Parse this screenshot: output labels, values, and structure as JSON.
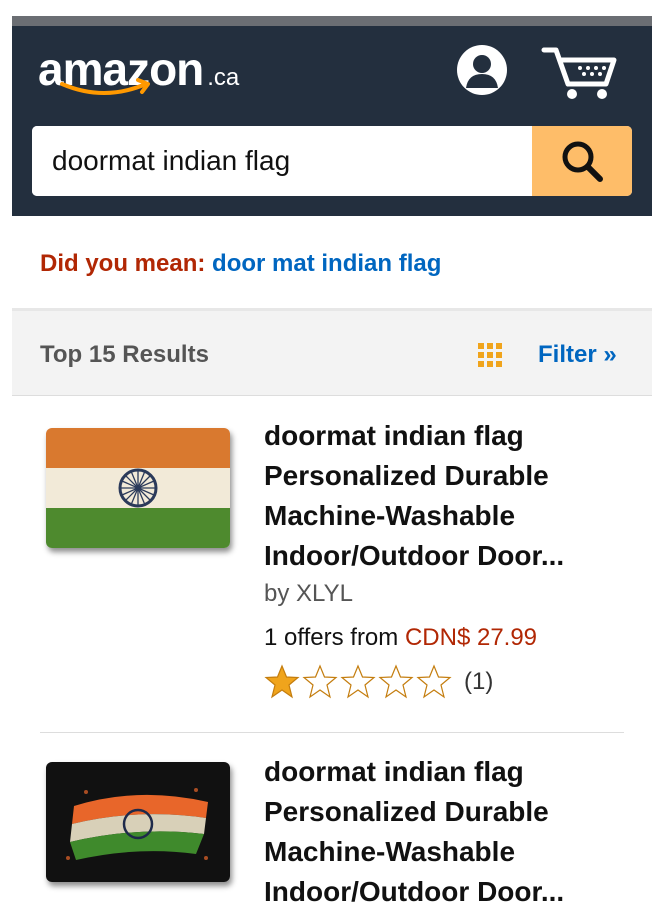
{
  "header": {
    "logo_text": "amazon",
    "logo_suffix": ".ca",
    "account_icon": "account-icon",
    "cart_icon": "cart-icon"
  },
  "search": {
    "value": "doormat indian flag",
    "button_icon": "search-icon"
  },
  "did_you_mean": {
    "label": "Did you mean:",
    "suggestion": "door mat indian flag"
  },
  "results_bar": {
    "count_text": "Top 15 Results",
    "filter_label": "Filter »"
  },
  "results": [
    {
      "title_lines": [
        "doormat indian flag",
        "Personalized Durable",
        "Machine-Washable",
        "Indoor/Outdoor Door..."
      ],
      "brand": "by XLYL",
      "offers_prefix": "1 offers from",
      "price": "CDN$ 27.99",
      "rating": 1,
      "rating_count": "(1)"
    },
    {
      "title_lines": [
        "doormat indian flag",
        "Personalized Durable",
        "Machine-Washable",
        "Indoor/Outdoor Door..."
      ]
    }
  ],
  "colors": {
    "header_bg": "#232f3e",
    "search_button": "#febd69",
    "link": "#0066c0",
    "price": "#b12704",
    "star": "#f0a41c"
  }
}
